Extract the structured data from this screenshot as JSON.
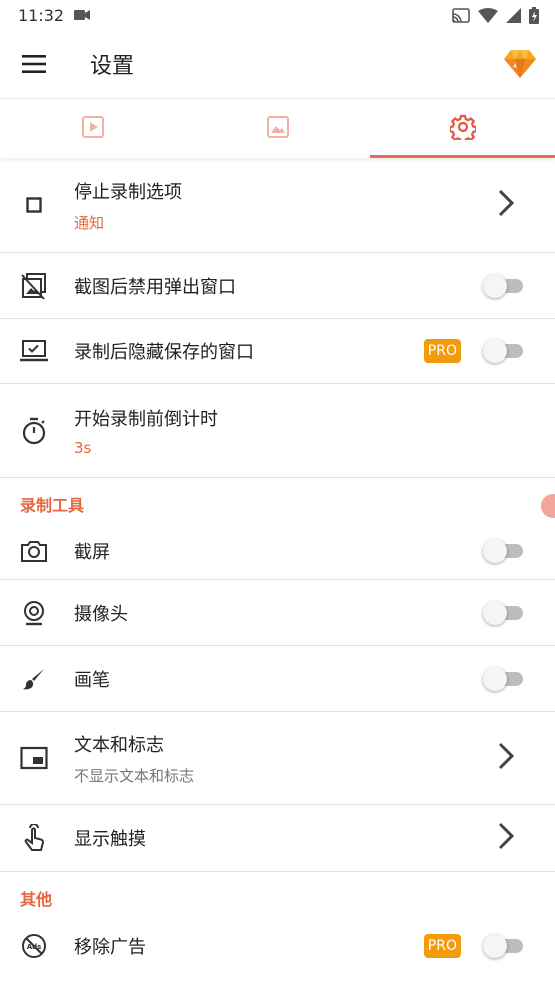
{
  "status": {
    "time": "11:32"
  },
  "app_bar": {
    "title": "设置"
  },
  "tabs": [
    {
      "name": "video-tab",
      "icon": "play-icon"
    },
    {
      "name": "image-tab",
      "icon": "image-icon"
    },
    {
      "name": "settings-tab",
      "icon": "gear-icon",
      "active": true
    }
  ],
  "rows": {
    "stop_options": {
      "primary": "停止录制选项",
      "secondary": "通知"
    },
    "disable_popup": {
      "primary": "截图后禁用弹出窗口"
    },
    "hide_saved": {
      "primary": "录制后隐藏保存的窗口",
      "badge": "PRO"
    },
    "countdown": {
      "primary": "开始录制前倒计时",
      "secondary": "3s"
    },
    "screenshot": {
      "primary": "截屏"
    },
    "camera": {
      "primary": "摄像头"
    },
    "brush": {
      "primary": "画笔"
    },
    "text_logo": {
      "primary": "文本和标志",
      "secondary": "不显示文本和标志"
    },
    "show_touch": {
      "primary": "显示触摸"
    },
    "remove_ads": {
      "primary": "移除广告",
      "badge": "PRO"
    }
  },
  "sections": {
    "tools": "录制工具",
    "other": "其他"
  },
  "colors": {
    "accent": "#e8663e",
    "tab_indicator": "#ea6b55",
    "pro": "#f29b0c"
  }
}
